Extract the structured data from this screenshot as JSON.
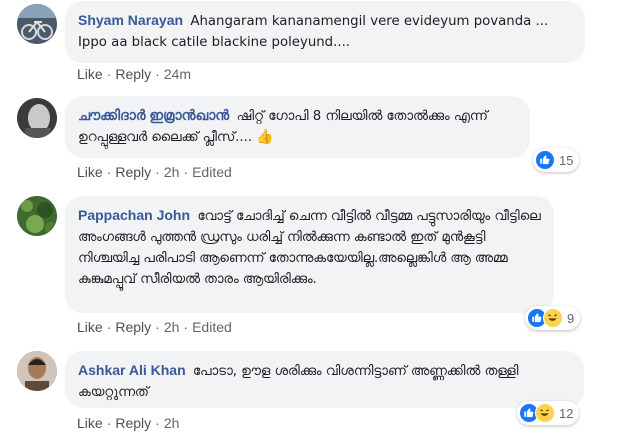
{
  "comments": [
    {
      "author": "Shyam Narayan",
      "text": "Ahangaram kananamengil vere evideyum povanda ... Ippo aa black catile blackine poleyund....",
      "actions": {
        "like": "Like",
        "reply": "Reply",
        "time": "24m"
      }
    },
    {
      "author": "ചൗക്കിദാർ ഇമ്രാൻഖാൻ",
      "text": "ഷിറ്റ് ഗോപി 8 നിലയിൽ തോൽക്കും എന്ന് ഉറപ്പുള്ളവർ ലൈക്ക് പ്ലീസ്....",
      "emoji": "👍",
      "actions": {
        "like": "Like",
        "reply": "Reply",
        "time": "2h",
        "edited": "Edited"
      },
      "reactions": {
        "count": "15",
        "types": [
          "like-icon"
        ]
      }
    },
    {
      "author": "Pappachan John",
      "text": "വോട്ട് ചോദിച്ച് ചെന്ന വീട്ടിൽ വീട്ടമ്മ പട്ടുസാരിയും വീട്ടിലെ അംഗങ്ങൾ പുത്തൻ ഡ്രസും ധരിച്ച് നിൽക്കുന്ന കണ്ടാൽ ഇത് മുൻകൂട്ടി നിശ്ചയിച്ച പരിപാടി ആണെന്ന് തോന്നുകയേയില്ല.അല്ലെങ്കിൾ ആ അമ്മ കുങ്കുമപ്പൂവ് സീരിയൽ താരം ആയിരിക്കും.",
      "actions": {
        "like": "Like",
        "reply": "Reply",
        "time": "2h",
        "edited": "Edited"
      },
      "reactions": {
        "count": "9",
        "types": [
          "like-icon",
          "haha-icon"
        ]
      }
    },
    {
      "author": "Ashkar Ali Khan",
      "text": "പോടാ, ഊള ശരിക്കും വിശന്നിട്ടാണ് അണ്ണക്കിൽ തള്ളി കയറ്റുന്നത്",
      "actions": {
        "like": "Like",
        "reply": "Reply",
        "time": "2h"
      },
      "reactions": {
        "count": "12",
        "types": [
          "like-icon",
          "haha-icon"
        ]
      }
    }
  ],
  "colors": {
    "author": "#385898",
    "bubble": "#f2f3f5",
    "meta": "#606770",
    "like_reaction": "#1877f2",
    "haha_reaction": "#fcd34d"
  }
}
